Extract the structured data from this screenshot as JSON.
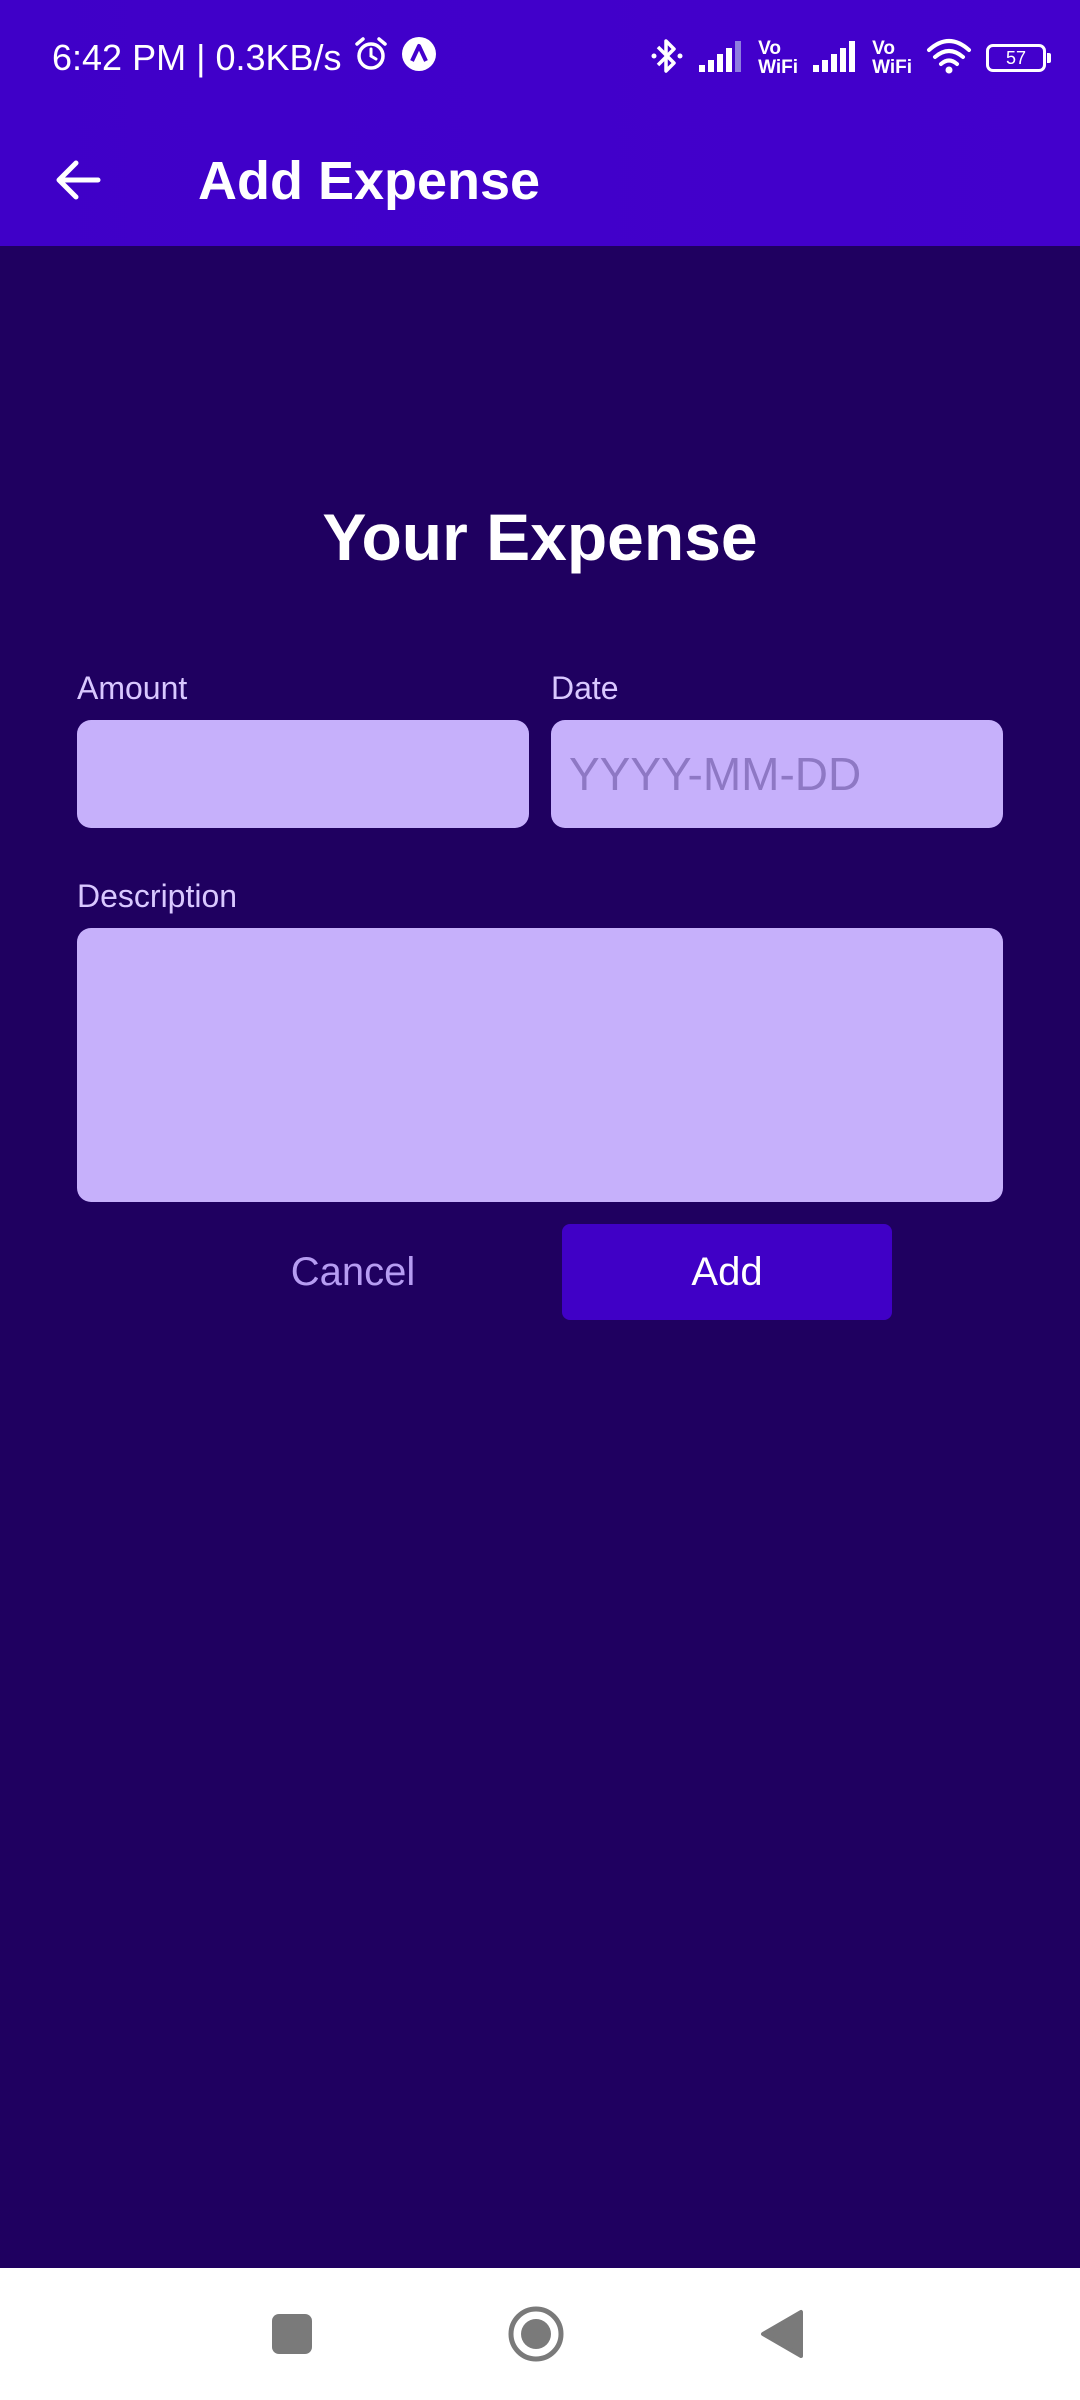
{
  "status_bar": {
    "time": "6:42 PM",
    "separator": "|",
    "net_speed": "0.3KB/s",
    "vo_label": "Vo",
    "wifi_label": "WiFi",
    "battery": "57"
  },
  "toolbar": {
    "title": "Add Expense"
  },
  "form": {
    "heading": "Your Expense",
    "amount_label": "Amount",
    "amount_value": "",
    "date_label": "Date",
    "date_placeholder": "YYYY-MM-DD",
    "description_label": "Description",
    "description_value": "",
    "cancel_label": "Cancel",
    "add_label": "Add"
  },
  "colors": {
    "appbar": "#4300cc",
    "background": "#1f0060",
    "field": "#c6b0fb",
    "button": "#4000c6",
    "cancel_text": "#b69cf2"
  },
  "icons": {
    "back": "arrow-left-icon",
    "alarm": "alarm-icon",
    "app_notification": "app-notification-icon",
    "bluetooth": "bluetooth-icon",
    "signal": "signal-icon",
    "wifi": "wifi-icon",
    "nav_recents": "square-icon",
    "nav_home": "circle-icon",
    "nav_back": "triangle-back-icon"
  }
}
